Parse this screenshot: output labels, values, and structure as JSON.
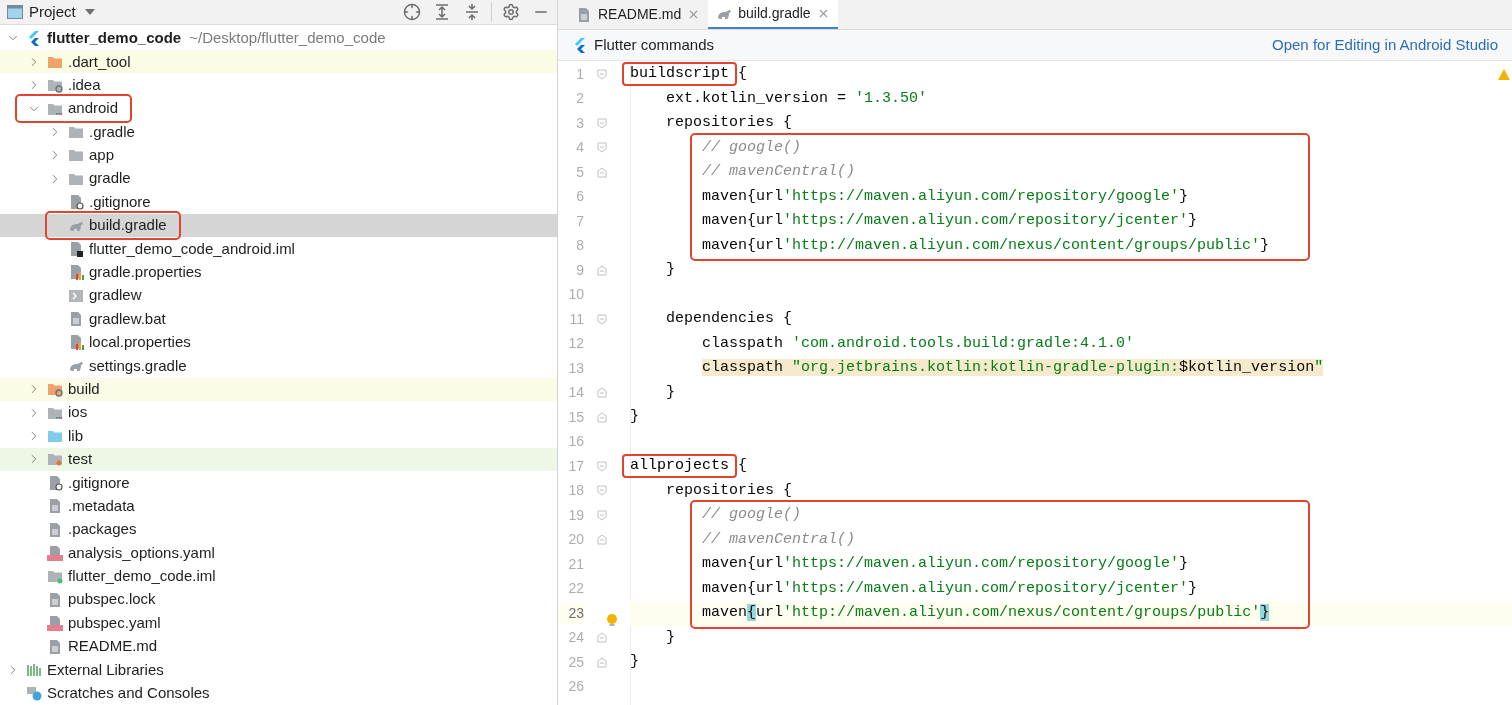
{
  "project_panel": {
    "title": "Project",
    "tree": [
      {
        "label": "flutter_demo_code",
        "path": "~/Desktop/flutter_demo_code",
        "kind": "flutter",
        "expanded": true,
        "selected": false,
        "annotated": false,
        "children": [
          {
            "label": ".dart_tool",
            "kind": "folder-excluded",
            "expanded": false,
            "selected": false,
            "annotated": false,
            "color": "#fbfbe6"
          },
          {
            "label": ".idea",
            "kind": "folder-config",
            "expanded": false,
            "selected": false,
            "annotated": false
          },
          {
            "label": "android",
            "kind": "folder-module",
            "expanded": true,
            "selected": false,
            "annotated": true,
            "children": [
              {
                "label": ".gradle",
                "kind": "folder",
                "expanded": false,
                "selected": false,
                "annotated": false
              },
              {
                "label": "app",
                "kind": "folder",
                "expanded": false,
                "selected": false,
                "annotated": false
              },
              {
                "label": "gradle",
                "kind": "folder",
                "expanded": false,
                "selected": false,
                "annotated": false
              },
              {
                "label": ".gitignore",
                "kind": "ignore-file",
                "selected": false,
                "annotated": false
              },
              {
                "label": "build.gradle",
                "kind": "gradle",
                "selected": true,
                "annotated": true
              },
              {
                "label": "flutter_demo_code_android.iml",
                "kind": "iml",
                "selected": false,
                "annotated": false
              },
              {
                "label": "gradle.properties",
                "kind": "properties",
                "selected": false,
                "annotated": false
              },
              {
                "label": "gradlew",
                "kind": "script",
                "selected": false,
                "annotated": false
              },
              {
                "label": "gradlew.bat",
                "kind": "text",
                "selected": false,
                "annotated": false
              },
              {
                "label": "local.properties",
                "kind": "properties",
                "selected": false,
                "annotated": false
              },
              {
                "label": "settings.gradle",
                "kind": "gradle",
                "selected": false,
                "annotated": false
              }
            ]
          },
          {
            "label": "build",
            "kind": "folder-excluded-config",
            "expanded": false,
            "selected": false,
            "annotated": false,
            "color": "#fbfbe6"
          },
          {
            "label": "ios",
            "kind": "folder-module",
            "expanded": false,
            "selected": false,
            "annotated": false
          },
          {
            "label": "lib",
            "kind": "folder-source",
            "expanded": false,
            "selected": false,
            "annotated": false
          },
          {
            "label": "test",
            "kind": "folder-test",
            "expanded": false,
            "selected": false,
            "annotated": false,
            "color": "#eef7e6"
          },
          {
            "label": ".gitignore",
            "kind": "ignore-file",
            "selected": false,
            "annotated": false
          },
          {
            "label": ".metadata",
            "kind": "text",
            "selected": false,
            "annotated": false
          },
          {
            "label": ".packages",
            "kind": "text",
            "selected": false,
            "annotated": false
          },
          {
            "label": "analysis_options.yaml",
            "kind": "yaml",
            "selected": false,
            "annotated": false
          },
          {
            "label": "flutter_demo_code.iml",
            "kind": "module-file",
            "selected": false,
            "annotated": false
          },
          {
            "label": "pubspec.lock",
            "kind": "text",
            "selected": false,
            "annotated": false
          },
          {
            "label": "pubspec.yaml",
            "kind": "yaml",
            "selected": false,
            "annotated": false
          },
          {
            "label": "README.md",
            "kind": "text",
            "selected": false,
            "annotated": false
          }
        ]
      },
      {
        "label": "External Libraries",
        "kind": "libraries",
        "expanded": false,
        "selected": false,
        "annotated": false
      },
      {
        "label": "Scratches and Consoles",
        "kind": "scratches",
        "selected": false,
        "annotated": false
      }
    ]
  },
  "editor": {
    "tabs": [
      {
        "label": "README.md",
        "kind": "text",
        "selected": false
      },
      {
        "label": "build.gradle",
        "kind": "gradle",
        "selected": true
      }
    ],
    "banner": {
      "label": "Flutter commands",
      "link": "Open for Editing in Android Studio"
    },
    "blocks": [
      {
        "annotated": false,
        "lines": [
          {
            "number": "1",
            "kind": "fold-start",
            "current": false,
            "tokens": [
              {
                "text": "buildscript",
                "kind": "boxed"
              },
              {
                "text": " {",
                "kind": "code"
              }
            ]
          },
          {
            "number": "2",
            "kind": "plain",
            "current": false,
            "tokens": [
              {
                "text": "    ext.kotlin_version = ",
                "kind": "code"
              },
              {
                "text": "'1.3.50'",
                "kind": "string"
              }
            ]
          },
          {
            "number": "3",
            "kind": "fold-start",
            "current": false,
            "tokens": [
              {
                "text": "    repositories {",
                "kind": "code"
              }
            ]
          }
        ]
      },
      {
        "annotated": true,
        "lines": [
          {
            "number": "4",
            "kind": "fold-start",
            "current": false,
            "tokens": [
              {
                "text": "        // google()",
                "kind": "comment"
              }
            ]
          },
          {
            "number": "5",
            "kind": "fold-end",
            "current": false,
            "tokens": [
              {
                "text": "        // mavenCentral()",
                "kind": "comment"
              }
            ]
          },
          {
            "number": "6",
            "kind": "plain",
            "current": false,
            "tokens": [
              {
                "text": "        maven{url",
                "kind": "code"
              },
              {
                "text": "'https://maven.aliyun.com/repository/google'",
                "kind": "string"
              },
              {
                "text": "}",
                "kind": "code"
              }
            ]
          },
          {
            "number": "7",
            "kind": "plain",
            "current": false,
            "tokens": [
              {
                "text": "        maven{url",
                "kind": "code"
              },
              {
                "text": "'https://maven.aliyun.com/repository/jcenter'",
                "kind": "string"
              },
              {
                "text": "}",
                "kind": "code"
              }
            ]
          },
          {
            "number": "8",
            "kind": "plain",
            "current": false,
            "tokens": [
              {
                "text": "        maven{url",
                "kind": "code"
              },
              {
                "text": "'http://maven.aliyun.com/nexus/content/groups/public'",
                "kind": "string"
              },
              {
                "text": "}",
                "kind": "code"
              }
            ]
          }
        ]
      },
      {
        "annotated": false,
        "lines": [
          {
            "number": "9",
            "kind": "fold-end",
            "current": false,
            "tokens": [
              {
                "text": "    }",
                "kind": "code"
              }
            ]
          },
          {
            "number": "10",
            "kind": "plain",
            "current": false
          },
          {
            "number": "11",
            "kind": "fold-start",
            "current": false,
            "tokens": [
              {
                "text": "    dependencies {",
                "kind": "code"
              }
            ]
          },
          {
            "number": "12",
            "kind": "plain",
            "current": false,
            "tokens": [
              {
                "text": "        classpath ",
                "kind": "code"
              },
              {
                "text": "'com.android.tools.build:gradle:4.1.0'",
                "kind": "string"
              }
            ]
          },
          {
            "number": "13",
            "kind": "plain",
            "current": false,
            "tokens": [
              {
                "text": "        classpath ",
                "kind": "code-marked"
              },
              {
                "text": "\"org.jetbrains.kotlin:kotlin-gradle-plugin:",
                "kind": "string-marked"
              },
              {
                "text": "$kotlin_version",
                "kind": "code-marked"
              },
              {
                "text": "\"",
                "kind": "string-marked"
              }
            ]
          },
          {
            "number": "14",
            "kind": "fold-end",
            "current": false,
            "tokens": [
              {
                "text": "    }",
                "kind": "code"
              }
            ]
          },
          {
            "number": "15",
            "kind": "fold-end",
            "current": false,
            "tokens": [
              {
                "text": "}",
                "kind": "code"
              }
            ]
          },
          {
            "number": "16",
            "kind": "plain",
            "current": false
          },
          {
            "number": "17",
            "kind": "fold-start",
            "current": false,
            "tokens": [
              {
                "text": "allprojects",
                "kind": "boxed"
              },
              {
                "text": " {",
                "kind": "code"
              }
            ]
          },
          {
            "number": "18",
            "kind": "fold-start",
            "current": false,
            "tokens": [
              {
                "text": "    repositories {",
                "kind": "code"
              }
            ]
          }
        ]
      },
      {
        "annotated": true,
        "lines": [
          {
            "number": "19",
            "kind": "fold-start",
            "current": false,
            "tokens": [
              {
                "text": "        // google()",
                "kind": "comment"
              }
            ]
          },
          {
            "number": "20",
            "kind": "fold-end",
            "current": false,
            "tokens": [
              {
                "text": "        // mavenCentral()",
                "kind": "comment"
              }
            ]
          },
          {
            "number": "21",
            "kind": "plain",
            "current": false,
            "tokens": [
              {
                "text": "        maven{url",
                "kind": "code"
              },
              {
                "text": "'https://maven.aliyun.com/repository/google'",
                "kind": "string"
              },
              {
                "text": "}",
                "kind": "code"
              }
            ]
          },
          {
            "number": "22",
            "kind": "plain",
            "current": false,
            "tokens": [
              {
                "text": "        maven{url",
                "kind": "code"
              },
              {
                "text": "'https://maven.aliyun.com/repository/jcenter'",
                "kind": "string"
              },
              {
                "text": "}",
                "kind": "code"
              }
            ]
          },
          {
            "number": "23",
            "kind": "plain",
            "current": true,
            "tokens": [
              {
                "text": "        maven",
                "kind": "code"
              },
              {
                "text": "{",
                "kind": "match"
              },
              {
                "text": "url",
                "kind": "code"
              },
              {
                "text": "'http://maven.aliyun.com/nexus/content/groups/public'",
                "kind": "string"
              },
              {
                "text": "}",
                "kind": "match"
              }
            ]
          }
        ]
      },
      {
        "annotated": false,
        "lines": [
          {
            "number": "24",
            "kind": "fold-end",
            "current": false,
            "tokens": [
              {
                "text": "    }",
                "kind": "code"
              }
            ]
          },
          {
            "number": "25",
            "kind": "fold-end",
            "current": false,
            "tokens": [
              {
                "text": "}",
                "kind": "code"
              }
            ]
          },
          {
            "number": "26",
            "kind": "plain",
            "current": false
          }
        ]
      }
    ]
  }
}
